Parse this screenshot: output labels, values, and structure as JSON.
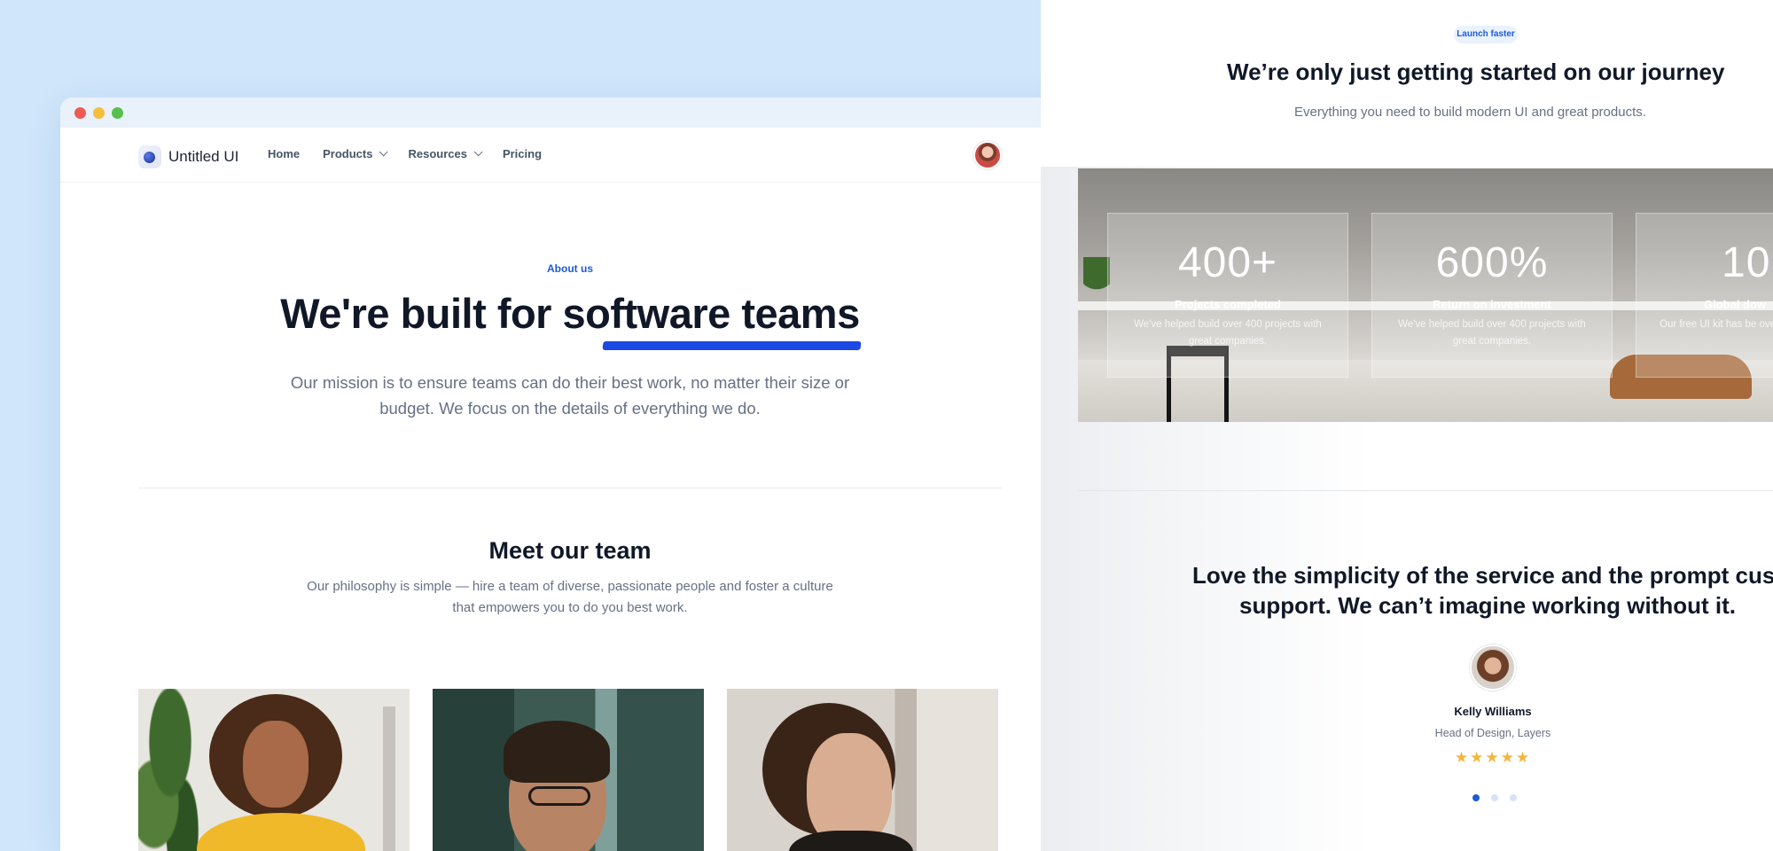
{
  "nav": {
    "brand": "Untitled UI",
    "links": {
      "home": "Home",
      "products": "Products",
      "resources": "Resources",
      "pricing": "Pricing"
    }
  },
  "hero": {
    "eyebrow": "About us",
    "title": "We're built for software teams",
    "subtitle": "Our mission is to ensure teams can do their best work, no matter their size or budget. We focus on the details of everything we do."
  },
  "team": {
    "title": "Meet our team",
    "subtitle": "Our philosophy is simple — hire a team of diverse, passionate people and foster a culture that empowers you to do you best work."
  },
  "journey": {
    "badge": "Launch faster",
    "title": "We’re only just getting started on our journey",
    "subtitle": "Everything you need to build modern UI and great products."
  },
  "stats": [
    {
      "value": "400+",
      "label": "Projects completed",
      "desc": "We've helped build over 400 projects with great companies."
    },
    {
      "value": "600%",
      "label": "Return on investment",
      "desc": "We've helped build over 400 projects with great companies."
    },
    {
      "value": "10",
      "label": "Global dow",
      "desc": "Our free UI kit has be over 10k ti"
    }
  ],
  "testimonial": {
    "quote": "Love the simplicity of the service and the prompt cust support. We can’t imagine working without it.",
    "name": "Kelly Williams",
    "role": "Head of Design, Layers",
    "stars": "★★★★★",
    "rating": 5,
    "page_count": 3,
    "active_page": 1
  },
  "colors": {
    "background": "#cfe6fb",
    "accent": "#1d5bd6",
    "underline": "#1c49e4",
    "star": "#f5b53b"
  }
}
